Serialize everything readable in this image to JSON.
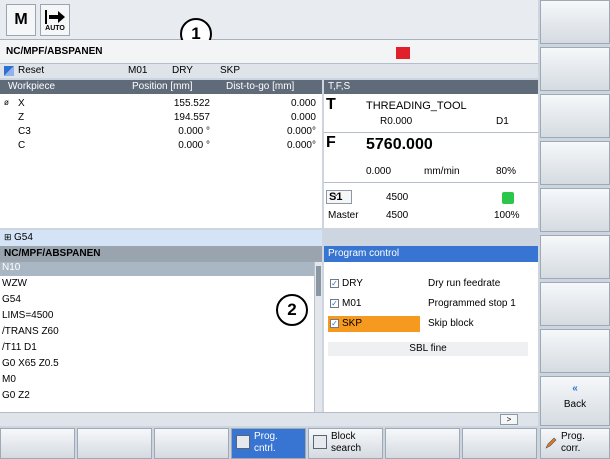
{
  "header": {
    "mode_icon_m": "M",
    "mode_icon_auto": "AUTO",
    "path": "NC/MPF/ABSPANEN"
  },
  "status": {
    "reset": "Reset",
    "m01": "M01",
    "dry": "DRY",
    "skp": "SKP"
  },
  "callouts": [
    "1",
    "2"
  ],
  "workpiece": {
    "col_name": "Workpiece",
    "col_pos": "Position [mm]",
    "col_dtg": "Dist-to-go [mm]",
    "axes": [
      {
        "prefix": "ø",
        "name": "X",
        "pos": "155.522",
        "dtg": "0.000"
      },
      {
        "prefix": "",
        "name": "Z",
        "pos": "194.557",
        "dtg": "0.000"
      },
      {
        "prefix": "",
        "name": "C3",
        "pos": "0.000 °",
        "dtg": "0.000°"
      },
      {
        "prefix": "",
        "name": "C",
        "pos": "0.000 °",
        "dtg": "0.000°"
      }
    ],
    "g54": "G54"
  },
  "tfs": {
    "header": "T,F,S",
    "t_label": "T",
    "tool": "THREADING_TOOL",
    "radius": "R0.000",
    "d": "D1",
    "f_label": "F",
    "feed": "5760.000",
    "feed_set": "0.000",
    "feed_unit": "mm/min",
    "feed_pct": "80%",
    "s_label": "S1",
    "s_value": "4500",
    "master_label": "Master",
    "master_value": "4500",
    "master_pct": "100%"
  },
  "program": {
    "path": "NC/MPF/ABSPANEN",
    "lines": [
      "N10",
      "WZW",
      "G54",
      "LIMS=4500",
      "/TRANS Z60",
      "/T11 D1",
      "G0 X65 Z0.5",
      "M0",
      "G0 Z2"
    ]
  },
  "program_control": {
    "title": "Program control",
    "options": [
      {
        "name": "DRY",
        "desc": "Dry run feedrate",
        "checked": true
      },
      {
        "name": "M01",
        "desc": "Programmed stop 1",
        "checked": true
      },
      {
        "name": "SKP",
        "desc": "Skip block",
        "checked": true
      }
    ],
    "sbl": "SBL fine"
  },
  "hscroll_btn": ">",
  "vertical_softkeys": [
    {
      "label": ""
    },
    {
      "label": ""
    },
    {
      "label": ""
    },
    {
      "label": ""
    },
    {
      "label": ""
    },
    {
      "label": ""
    },
    {
      "label": ""
    },
    {
      "label": ""
    },
    {
      "label": "«\nBack"
    }
  ],
  "back": {
    "arrows": "«",
    "label": "Back"
  },
  "horizontal_softkeys": {
    "prog_cntrl": [
      "Prog.",
      "cntrl."
    ],
    "block_search": [
      "Block",
      "search"
    ],
    "prog_corr": [
      "Prog.",
      "corr."
    ]
  },
  "colors": {
    "accent": "#3874d1",
    "highlight": "#f59a1e",
    "alarm": "#e0202a",
    "spindle_ok": "#2cc74a"
  }
}
